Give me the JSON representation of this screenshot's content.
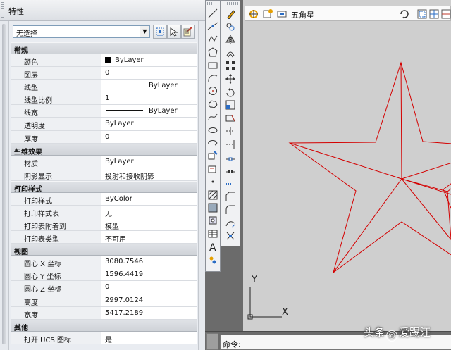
{
  "properties_palette": {
    "title": "特性",
    "selection": "无选择",
    "categories": [
      {
        "name": "常规",
        "rows": [
          {
            "key": "颜色",
            "value": "ByLayer",
            "kind": "color"
          },
          {
            "key": "图层",
            "value": "0"
          },
          {
            "key": "线型",
            "value": "ByLayer",
            "kind": "line"
          },
          {
            "key": "线型比例",
            "value": "1"
          },
          {
            "key": "线宽",
            "value": "ByLayer",
            "kind": "line"
          },
          {
            "key": "透明度",
            "value": "ByLayer"
          },
          {
            "key": "厚度",
            "value": "0"
          }
        ]
      },
      {
        "name": "三维效果",
        "rows": [
          {
            "key": "材质",
            "value": "ByLayer"
          },
          {
            "key": "阴影显示",
            "value": "投射和接收阴影"
          }
        ]
      },
      {
        "name": "打印样式",
        "rows": [
          {
            "key": "打印样式",
            "value": "ByColor"
          },
          {
            "key": "打印样式表",
            "value": "无"
          },
          {
            "key": "打印表附着到",
            "value": "模型"
          },
          {
            "key": "打印表类型",
            "value": "不可用"
          }
        ]
      },
      {
        "name": "视图",
        "rows": [
          {
            "key": "圆心 X 坐标",
            "value": "3080.7546"
          },
          {
            "key": "圆心 Y 坐标",
            "value": "1596.4419"
          },
          {
            "key": "圆心 Z 坐标",
            "value": "0"
          },
          {
            "key": "高度",
            "value": "2997.0124"
          },
          {
            "key": "宽度",
            "value": "5417.2189"
          }
        ]
      },
      {
        "name": "其他",
        "rows": [
          {
            "key": "打开 UCS 图标",
            "value": "是"
          }
        ]
      }
    ]
  },
  "viewport_toolbar": {
    "view_name": "五角星"
  },
  "ucs": {
    "x_label": "X",
    "y_label": "Y"
  },
  "command_line": {
    "prompt": "命令:"
  },
  "watermark": {
    "text_before": "头条",
    "text_after": "爱踢汪"
  },
  "colors": {
    "star_stroke": "#d40000",
    "canvas": "#cfcfcf"
  }
}
